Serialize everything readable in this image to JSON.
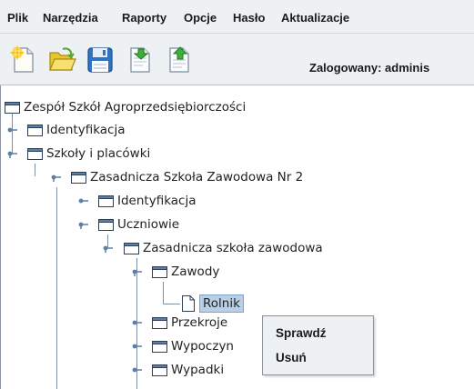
{
  "menubar": {
    "items": [
      "Plik",
      "Narzędzia",
      "Raporty",
      "Opcje",
      "Hasło",
      "Aktualizacje"
    ]
  },
  "toolbar": {
    "buttons": [
      "new-icon",
      "open-folder-icon",
      "save-icon",
      "document-import-icon",
      "document-export-icon"
    ],
    "login_text": "Zalogowany: adminis"
  },
  "tree": {
    "nodes": [
      {
        "label": "Zespół Szkół Agroprzedsiębiorczości",
        "icon": "folder-icon"
      },
      {
        "label": "Identyfikacja",
        "icon": "folder-icon"
      },
      {
        "label": "Szkoły i placówki",
        "icon": "folder-icon"
      },
      {
        "label": "Zasadnicza Szkoła Zawodowa Nr 2",
        "icon": "folder-icon"
      },
      {
        "label": "Identyfikacja",
        "icon": "folder-icon"
      },
      {
        "label": "Uczniowie",
        "icon": "folder-icon"
      },
      {
        "label": "Zasadnicza szkoła zawodowa",
        "icon": "folder-icon"
      },
      {
        "label": "Zawody",
        "icon": "folder-icon"
      },
      {
        "label": "Rolnik",
        "icon": "file-icon",
        "selected": true
      },
      {
        "label": "Przekroje",
        "icon": "folder-icon"
      },
      {
        "label": "Wypoczyn",
        "icon": "folder-icon"
      },
      {
        "label": "Wypadki",
        "icon": "folder-icon"
      }
    ]
  },
  "context_menu": {
    "items": [
      "Sprawdź",
      "Usuń"
    ]
  },
  "colors": {
    "menubar_bg": "#eef1f4",
    "selection_bg": "#b8cfe5",
    "folder_blue": "#5b7fa6"
  }
}
